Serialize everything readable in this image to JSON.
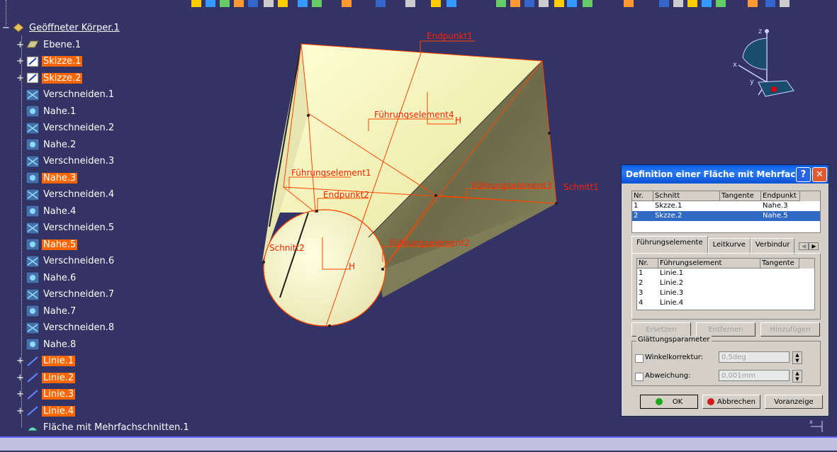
{
  "colors": {
    "background": "#333366",
    "highlight": "#ff6600",
    "surface": "#ffffcc",
    "geometry": "#ff4400",
    "select": "#316ac5"
  },
  "tree": {
    "root": "Geöffneter Körper.1",
    "items": [
      {
        "label": "Ebene.1",
        "icon": "plane-icon",
        "hl": false,
        "exp": true
      },
      {
        "label": "Skizze.1",
        "icon": "sketch-icon",
        "hl": true,
        "exp": true
      },
      {
        "label": "Skizze.2",
        "icon": "sketch-icon",
        "hl": true,
        "exp": true
      },
      {
        "label": "Verschneiden.1",
        "icon": "intersect-icon",
        "hl": false,
        "exp": false
      },
      {
        "label": "Nahe.1",
        "icon": "near-icon",
        "hl": false,
        "exp": false
      },
      {
        "label": "Verschneiden.2",
        "icon": "intersect-icon",
        "hl": false,
        "exp": false
      },
      {
        "label": "Nahe.2",
        "icon": "near-icon",
        "hl": false,
        "exp": false
      },
      {
        "label": "Verschneiden.3",
        "icon": "intersect-icon",
        "hl": false,
        "exp": false
      },
      {
        "label": "Nahe.3",
        "icon": "near-icon",
        "hl": true,
        "exp": false
      },
      {
        "label": "Verschneiden.4",
        "icon": "intersect-icon",
        "hl": false,
        "exp": false
      },
      {
        "label": "Nahe.4",
        "icon": "near-icon",
        "hl": false,
        "exp": false
      },
      {
        "label": "Verschneiden.5",
        "icon": "intersect-icon",
        "hl": false,
        "exp": false
      },
      {
        "label": "Nahe.5",
        "icon": "near-icon",
        "hl": true,
        "exp": false
      },
      {
        "label": "Verschneiden.6",
        "icon": "intersect-icon",
        "hl": false,
        "exp": false
      },
      {
        "label": "Nahe.6",
        "icon": "near-icon",
        "hl": false,
        "exp": false
      },
      {
        "label": "Verschneiden.7",
        "icon": "intersect-icon",
        "hl": false,
        "exp": false
      },
      {
        "label": "Nahe.7",
        "icon": "near-icon",
        "hl": false,
        "exp": false
      },
      {
        "label": "Verschneiden.8",
        "icon": "intersect-icon",
        "hl": false,
        "exp": false
      },
      {
        "label": "Nahe.8",
        "icon": "near-icon",
        "hl": false,
        "exp": false
      },
      {
        "label": "Linie.1",
        "icon": "line-icon",
        "hl": true,
        "exp": true
      },
      {
        "label": "Linie.2",
        "icon": "line-icon",
        "hl": true,
        "exp": true
      },
      {
        "label": "Linie.3",
        "icon": "line-icon",
        "hl": true,
        "exp": true
      },
      {
        "label": "Linie.4",
        "icon": "line-icon",
        "hl": true,
        "exp": true
      },
      {
        "label": "Fläche mit Mehrfachschnitten.1",
        "icon": "multisection-surface-icon",
        "hl": false,
        "exp": false
      }
    ]
  },
  "viewport": {
    "labels": {
      "endpunkt1": "Endpunkt1",
      "endpunkt2": "Endpunkt2",
      "fuehrung1": "Führungselement1",
      "fuehrung2": "Führungselement2",
      "fuehrung3": "Führungselement3",
      "fuehrung4": "Führungselement4",
      "schnitt1": "Schnitt1",
      "schnitt2": "Schnitt2",
      "h1": "H",
      "h2": "H"
    },
    "axes": {
      "x": "x",
      "y": "y",
      "z": "z"
    }
  },
  "dialog": {
    "title": "Definition einer Fläche mit Mehrfach...",
    "help": "?",
    "close": "✕",
    "sections_table": {
      "headers": [
        "Nr.",
        "Schnitt",
        "Tangente",
        "Endpunkt"
      ],
      "rows": [
        [
          "1",
          "Skzze.1",
          "",
          "Nahe.3"
        ],
        [
          "2",
          "Skzze.2",
          "",
          "Nahe.5"
        ]
      ]
    },
    "tabs": [
      "Führungselemente",
      "Leitkurve",
      "Verbindur"
    ],
    "guides_table": {
      "headers": [
        "Nr.",
        "Führungselement",
        "Tangente"
      ],
      "rows": [
        [
          "1",
          "Linie.1",
          ""
        ],
        [
          "2",
          "Linie.2",
          ""
        ],
        [
          "3",
          "Linie.3",
          ""
        ],
        [
          "4",
          "Linie.4",
          ""
        ]
      ]
    },
    "buttons": {
      "replace": "Ersetzen",
      "remove": "Entfernen",
      "add": "Hinzufügen"
    },
    "smoothing": {
      "title": "Glättungsparameter",
      "angle_label": "Winkelkorrektur:",
      "angle_value": "0,5deg",
      "deviation_label": "Abweichung:",
      "deviation_value": "0,001mm"
    },
    "ok": "OK",
    "cancel": "Abbrechen",
    "preview": "Voranzeige"
  }
}
